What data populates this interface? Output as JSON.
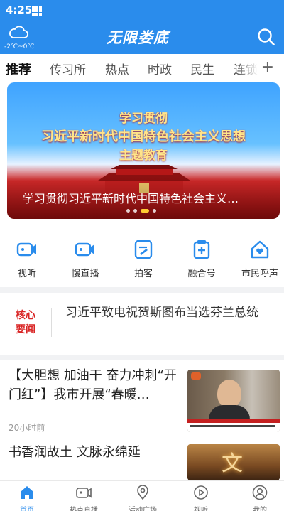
{
  "status_bar": {
    "time": "4:25"
  },
  "header": {
    "app_logo": "无限娄底",
    "weather": {
      "temp": "-2℃~0℃",
      "icon": "cloud-icon"
    },
    "search_icon": "search-icon"
  },
  "tabs": {
    "items": [
      "推荐",
      "传习所",
      "热点",
      "时政",
      "民生",
      "连锁"
    ],
    "active": "推荐",
    "add_label": "+"
  },
  "banner": {
    "headline_line1": "学习贯彻",
    "headline_line2": "习近平新时代中国特色社会主义思想",
    "headline_line3": "主题教育",
    "caption": "学习贯彻习近平新时代中国特色社会主义…",
    "slide_index": 2,
    "slide_count": 4
  },
  "quick_menu": [
    {
      "label": "视听",
      "icon": "camera-icon"
    },
    {
      "label": "慢直播",
      "icon": "video-camera-icon"
    },
    {
      "label": "拍客",
      "icon": "edit-icon"
    },
    {
      "label": "融合号",
      "icon": "plus-card-icon"
    },
    {
      "label": "市民呼声",
      "icon": "home-heart-icon"
    }
  ],
  "core_news": {
    "badge_line1": "核心",
    "badge_line2": "要闻",
    "text": "习近平致电祝贺斯图布当选芬兰总统"
  },
  "news": [
    {
      "title": "【大胆想 加油干 奋力冲刺“开门红”】我市开展“春暖…",
      "time": "20小时前",
      "thumb_caption": "",
      "thumb_icon": "news-photo-icon"
    },
    {
      "title": "书香润故土 文脉永绵延",
      "time": "",
      "thumb_glyph": "文",
      "thumb_icon": "culture-photo-icon"
    }
  ],
  "bottom_nav": [
    {
      "label": "首页",
      "icon": "home-icon",
      "active": true
    },
    {
      "label": "热点直播",
      "icon": "live-camera-icon",
      "active": false
    },
    {
      "label": "活动广场",
      "icon": "location-pin-icon",
      "active": false
    },
    {
      "label": "视听",
      "icon": "play-circle-icon",
      "active": false
    },
    {
      "label": "我的",
      "icon": "user-icon",
      "active": false
    }
  ],
  "colors": {
    "brand_blue": "#2a8cec",
    "badge_red": "#d92626",
    "banner_red": "#c42020"
  }
}
